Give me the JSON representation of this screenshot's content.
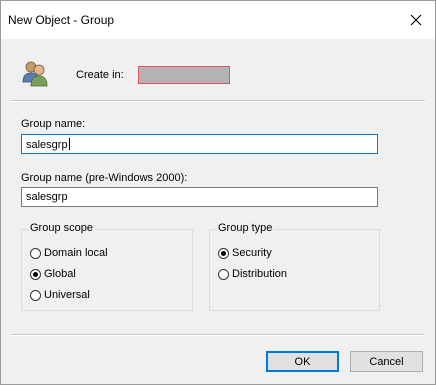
{
  "window": {
    "title": "New Object - Group"
  },
  "header": {
    "create_in_label": "Create in:",
    "create_in_value": ""
  },
  "form": {
    "group_name_label": "Group name:",
    "group_name_value": "salesgrp",
    "pre2000_label": "Group name (pre-Windows 2000):",
    "pre2000_value": "salesgrp"
  },
  "group_scope": {
    "legend": "Group scope",
    "options": [
      {
        "label": "Domain local",
        "checked": false
      },
      {
        "label": "Global",
        "checked": true
      },
      {
        "label": "Universal",
        "checked": false
      }
    ]
  },
  "group_type": {
    "legend": "Group type",
    "options": [
      {
        "label": "Security",
        "checked": true
      },
      {
        "label": "Distribution",
        "checked": false
      }
    ]
  },
  "buttons": {
    "ok": "OK",
    "cancel": "Cancel"
  },
  "colors": {
    "accent": "#0078d7",
    "redacted": "#b3b3b3",
    "redacted_border": "#e05555"
  }
}
